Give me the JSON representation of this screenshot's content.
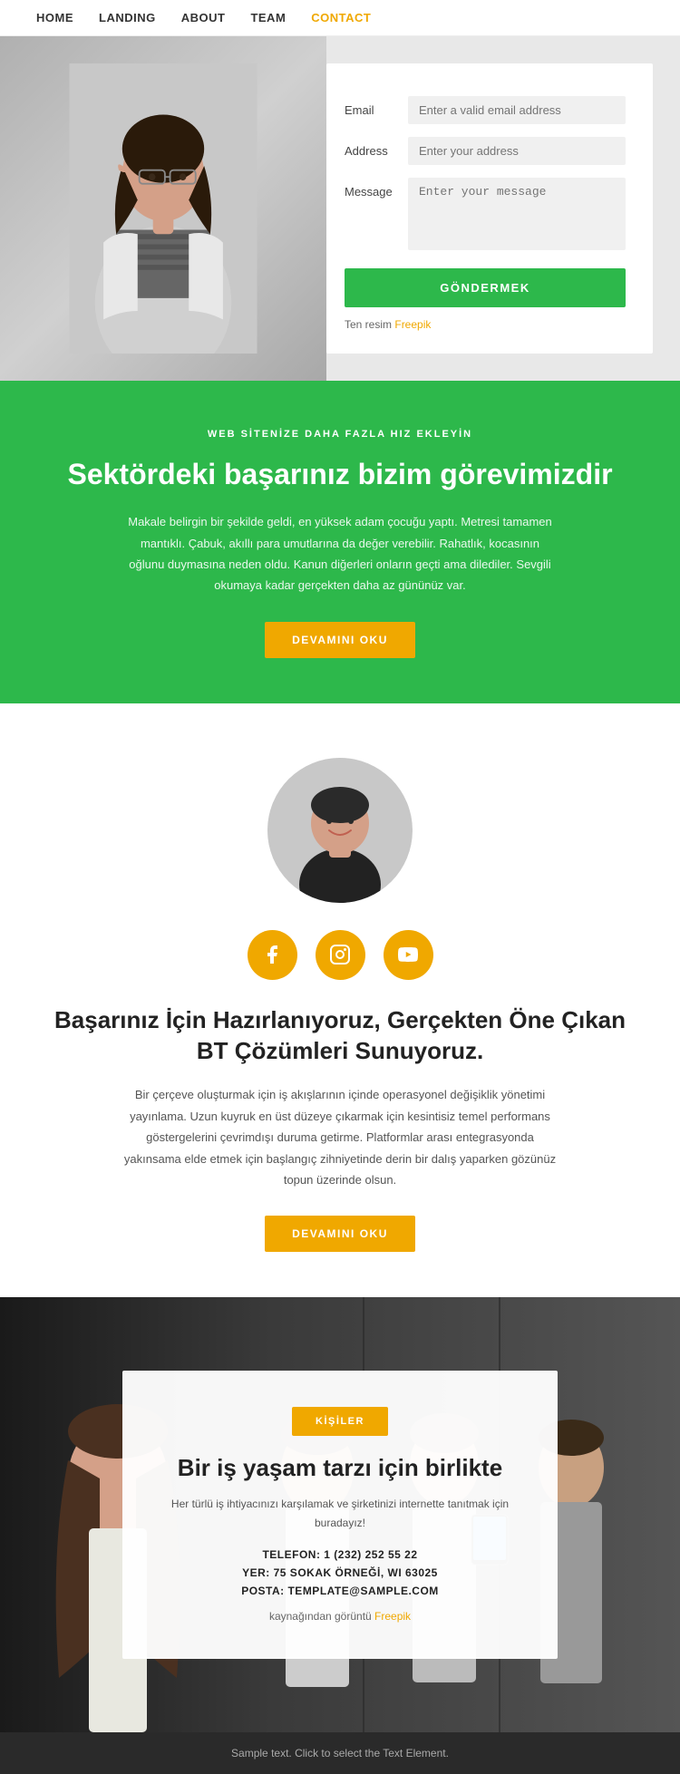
{
  "nav": {
    "items": [
      {
        "label": "HOME",
        "active": false
      },
      {
        "label": "LANDING",
        "active": false
      },
      {
        "label": "ABOUT",
        "active": false
      },
      {
        "label": "TEAM",
        "active": false
      },
      {
        "label": "CONTACT",
        "active": true
      }
    ]
  },
  "contact_section": {
    "email_label": "Email",
    "email_placeholder": "Enter a valid email address",
    "address_label": "Address",
    "address_placeholder": "Enter your address",
    "message_label": "Message",
    "message_placeholder": "Enter your message",
    "submit_button": "GÖNDERMEK",
    "credit_prefix": "Ten resim",
    "credit_link": "Freepik"
  },
  "green_section": {
    "sub_label": "WEB SİTENİZE DAHA FAZLA HIZ EKLEYİN",
    "heading": "Sektördeki başarınız bizim görevimizdir",
    "body": "Makale belirgin bir şekilde geldi, en yüksek adam çocuğu yaptı. Metresi tamamen mantıklı. Çabuk, akıllı para umutlarına da değer verebilir. Rahatlık, kocasının oğlunu duymasına neden oldu. Kanun diğerleri onların geçti ama dilediler. Sevgili okumaya kadar gerçekten daha az gününüz var.",
    "button": "DEVAMINI OKU"
  },
  "profile_section": {
    "social": [
      {
        "name": "facebook",
        "icon": "f"
      },
      {
        "name": "instagram",
        "icon": "📷"
      },
      {
        "name": "youtube",
        "icon": "▶"
      }
    ],
    "heading": "Başarınız İçin Hazırlanıyoruz, Gerçekten Öne Çıkan BT Çözümleri Sunuyoruz.",
    "body": "Bir çerçeve oluşturmak için iş akışlarının içinde operasyonel değişiklik yönetimi yayınlama. Uzun kuyruk en üst düzeye çıkarmak için kesintisiz temel performans göstergelerini çevrimdışı duruma getirme. Platformlar arası entegrasyonda yakınsama elde etmek için başlangıç zihniyetinde derin bir dalış yaparken gözünüz topun üzerinde olsun.",
    "button": "DEVAMINI OKU"
  },
  "team_section": {
    "badge": "KİŞİLER",
    "heading": "Bir iş yaşam tarzı için birlikte",
    "desc": "Her türlü iş ihtiyacınızı karşılamak ve şirketinizi internette tanıtmak için buradayız!",
    "phone_label": "TELEFON: 1 (232) 252 55 22",
    "location_label": "YER: 75 SOKAK ÖRNEĞİ, WI 63025",
    "email_label": "POSTA: TEMPLATE@SAMPLE.COM",
    "credit_prefix": "kaynağından görüntü",
    "credit_link": "Freepik"
  },
  "footer": {
    "text": "Sample text. Click to select the Text Element."
  }
}
